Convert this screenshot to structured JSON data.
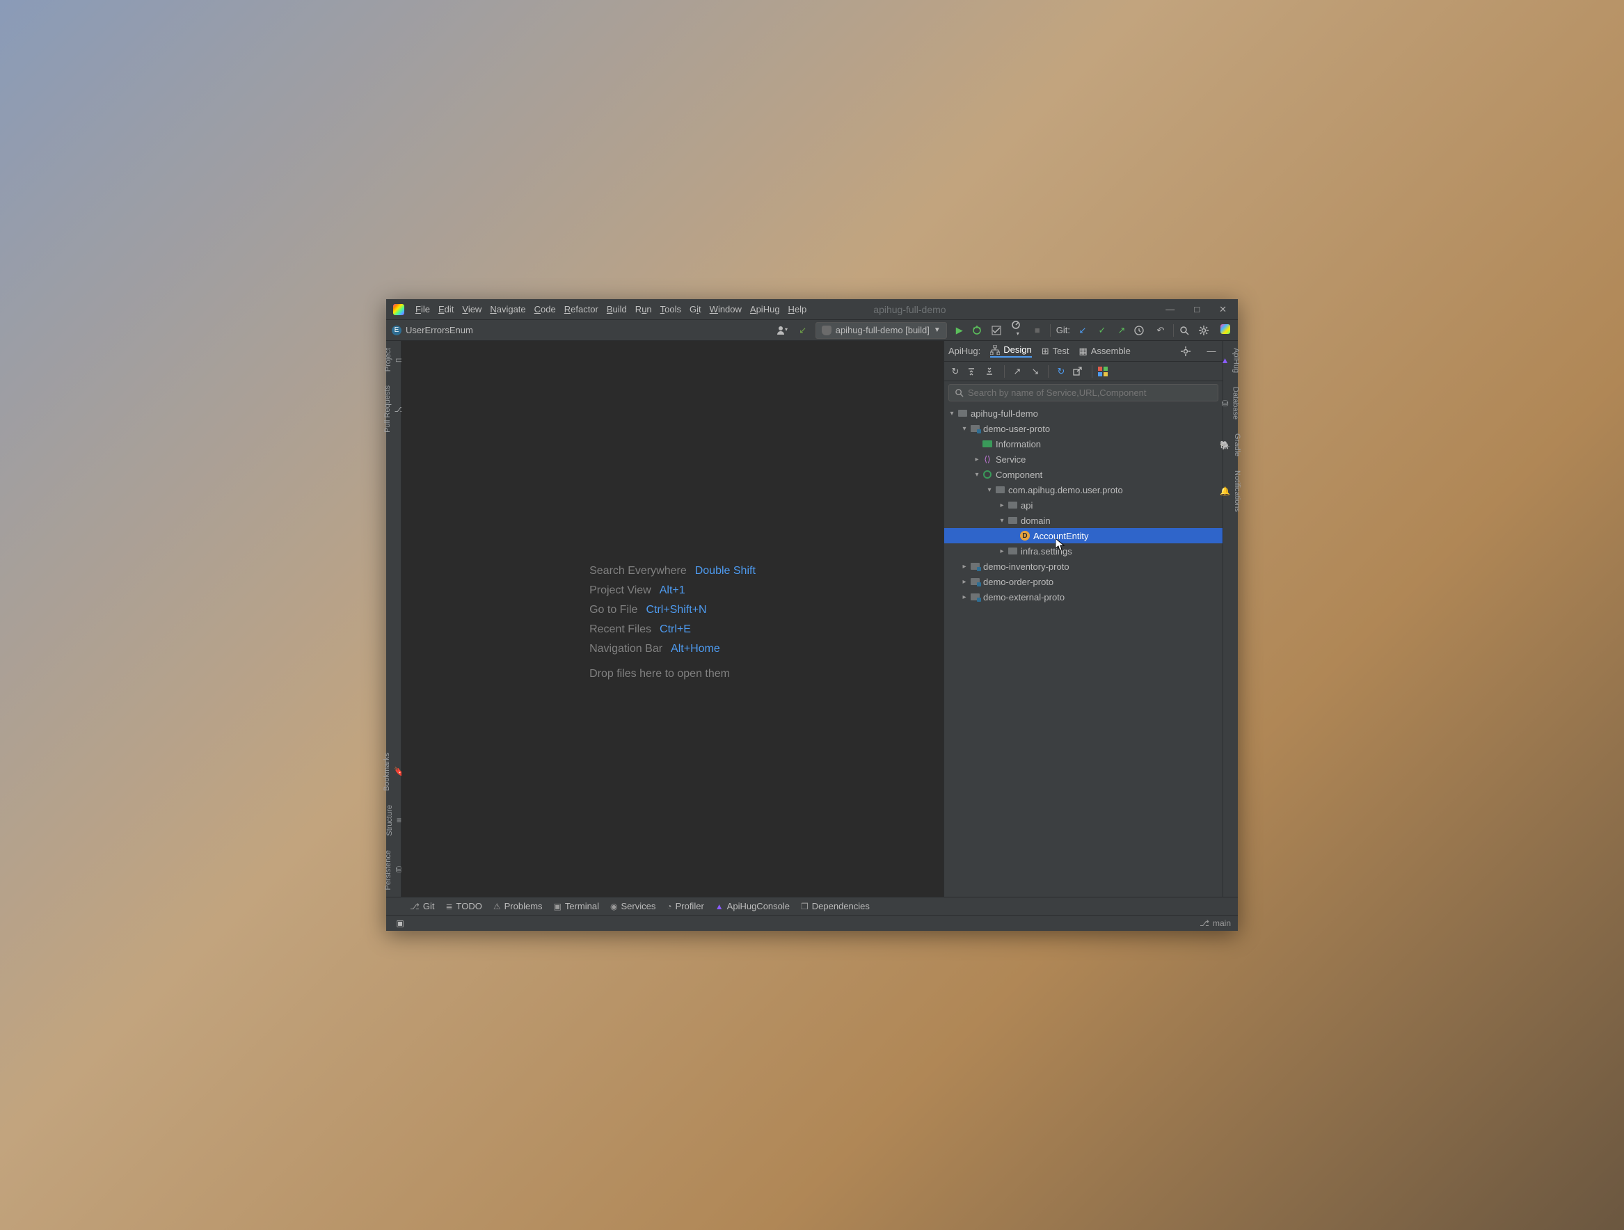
{
  "title_project": "apihug-full-demo",
  "menu": [
    "File",
    "Edit",
    "View",
    "Navigate",
    "Code",
    "Refactor",
    "Build",
    "Run",
    "Tools",
    "Git",
    "Window",
    "ApiHug",
    "Help"
  ],
  "breadcrumb": {
    "badge": "E",
    "file": "UserErrorsEnum"
  },
  "run_config": "apihug-full-demo [build]",
  "git_label": "Git:",
  "left_gutter": [
    "Project",
    "Pull Requests",
    "Bookmarks",
    "Structure",
    "Persistence"
  ],
  "right_gutter": [
    "ApiHug",
    "Database",
    "Gradle",
    "Notifications"
  ],
  "editor_shortcuts": [
    {
      "label": "Search Everywhere",
      "keys": "Double Shift"
    },
    {
      "label": "Project View",
      "keys": "Alt+1"
    },
    {
      "label": "Go to File",
      "keys": "Ctrl+Shift+N"
    },
    {
      "label": "Recent Files",
      "keys": "Ctrl+E"
    },
    {
      "label": "Navigation Bar",
      "keys": "Alt+Home"
    }
  ],
  "editor_drop_hint": "Drop files here to open them",
  "panel": {
    "label": "ApiHug:",
    "tabs": [
      "Design",
      "Test",
      "Assemble"
    ],
    "search_placeholder": "Search by name of Service,URL,Component"
  },
  "tree": {
    "root": "apihug-full-demo",
    "module1": "demo-user-proto",
    "info": "Information",
    "service": "Service",
    "component": "Component",
    "package": "com.apihug.demo.user.proto",
    "api": "api",
    "domain": "domain",
    "entity": "AccountEntity",
    "infra": "infra.settings",
    "module2": "demo-inventory-proto",
    "module3": "demo-order-proto",
    "module4": "demo-external-proto"
  },
  "bottombar": [
    "Git",
    "TODO",
    "Problems",
    "Terminal",
    "Services",
    "Profiler",
    "ApiHugConsole",
    "Dependencies"
  ],
  "status_branch": "main"
}
